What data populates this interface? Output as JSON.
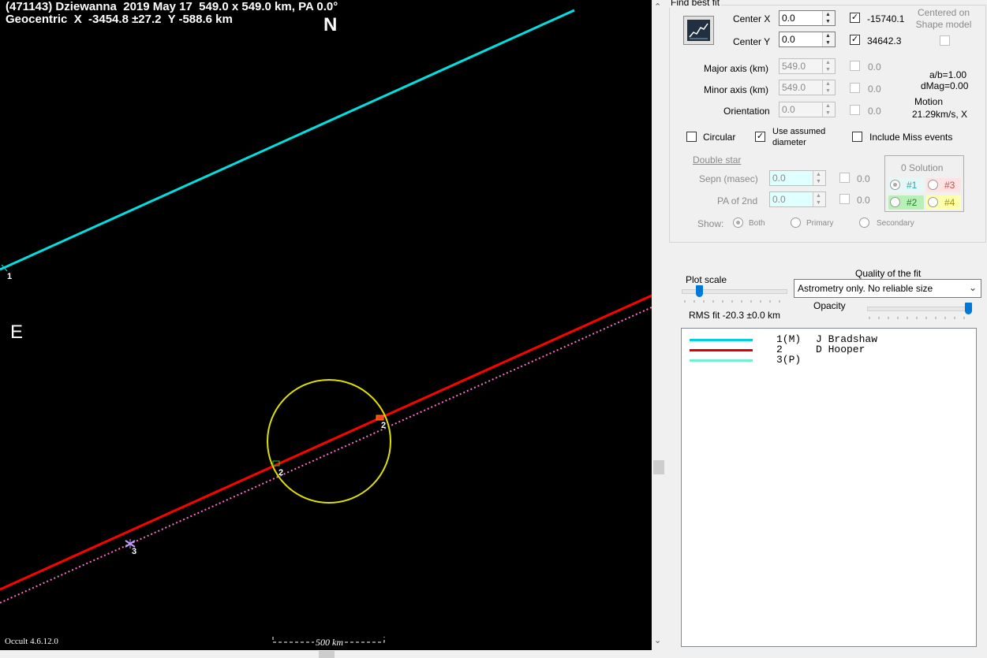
{
  "plot": {
    "title_line1": "(471143) Dziewanna  2019 May 17  549.0 x 549.0 km, PA 0.0°",
    "title_line2": "Geocentric  X  -3454.8 ±27.2  Y -588.6 km",
    "north_label": "N",
    "east_label": "E",
    "version": "Occult 4.6.12.0",
    "scale_label": "500 km",
    "chord_labels": [
      "1",
      "2",
      "2",
      "3"
    ]
  },
  "colors": {
    "chord1": "#00e0e0",
    "chord2": "#ff0000",
    "chord3": "#ff60c0",
    "ellipse": "#e0e000",
    "background": "#000000"
  },
  "panel": {
    "find_best_fit": "Find best fit",
    "center_x_label": "Center X",
    "center_x_value": "0.0",
    "center_x_offset": "-15740.1",
    "center_y_label": "Center Y",
    "center_y_value": "0.0",
    "center_y_offset": "34642.3",
    "centered_on_shape": "Centered on Shape model",
    "major_axis_label": "Major axis (km)",
    "major_axis_value": "549.0",
    "major_axis_fit": "0.0",
    "minor_axis_label": "Minor axis (km)",
    "minor_axis_value": "549.0",
    "minor_axis_fit": "0.0",
    "orientation_label": "Orientation",
    "orientation_value": "0.0",
    "orientation_fit": "0.0",
    "ab_ratio": "a/b=1.00",
    "dmag": "dMag=0.00",
    "motion_label": "Motion",
    "motion_value": "21.29km/s, X",
    "circular_label": "Circular",
    "use_assumed_label": "Use assumed diameter",
    "include_miss_label": "Include Miss events",
    "double_star_label": "Double star",
    "sepn_label": "Sepn (masec)",
    "sepn_value": "0.0",
    "sepn_fit": "0.0",
    "pa2_label": "PA of 2nd",
    "pa2_value": "0.0",
    "pa2_fit": "0.0",
    "solution_label": "0 Solution",
    "sol1": "#1",
    "sol2": "#2",
    "sol3": "#3",
    "sol4": "#4",
    "show_label": "Show:",
    "show_both": "Both",
    "show_primary": "Primary",
    "show_secondary": "Secondary",
    "plot_scale_label": "Plot scale",
    "quality_label": "Quality of the fit",
    "quality_value": "Astrometry only. No reliable size",
    "opacity_label": "Opacity",
    "rms_fit": "RMS fit -20.3 ±0.0 km"
  },
  "legend": [
    {
      "num": "1(M)",
      "name": "J Bradshaw",
      "color": "#00d0e0"
    },
    {
      "num": "2",
      "name": "D Hooper",
      "color": "#e00000"
    },
    {
      "num": "3(P)",
      "name": "",
      "color": "#70f0d0"
    }
  ]
}
